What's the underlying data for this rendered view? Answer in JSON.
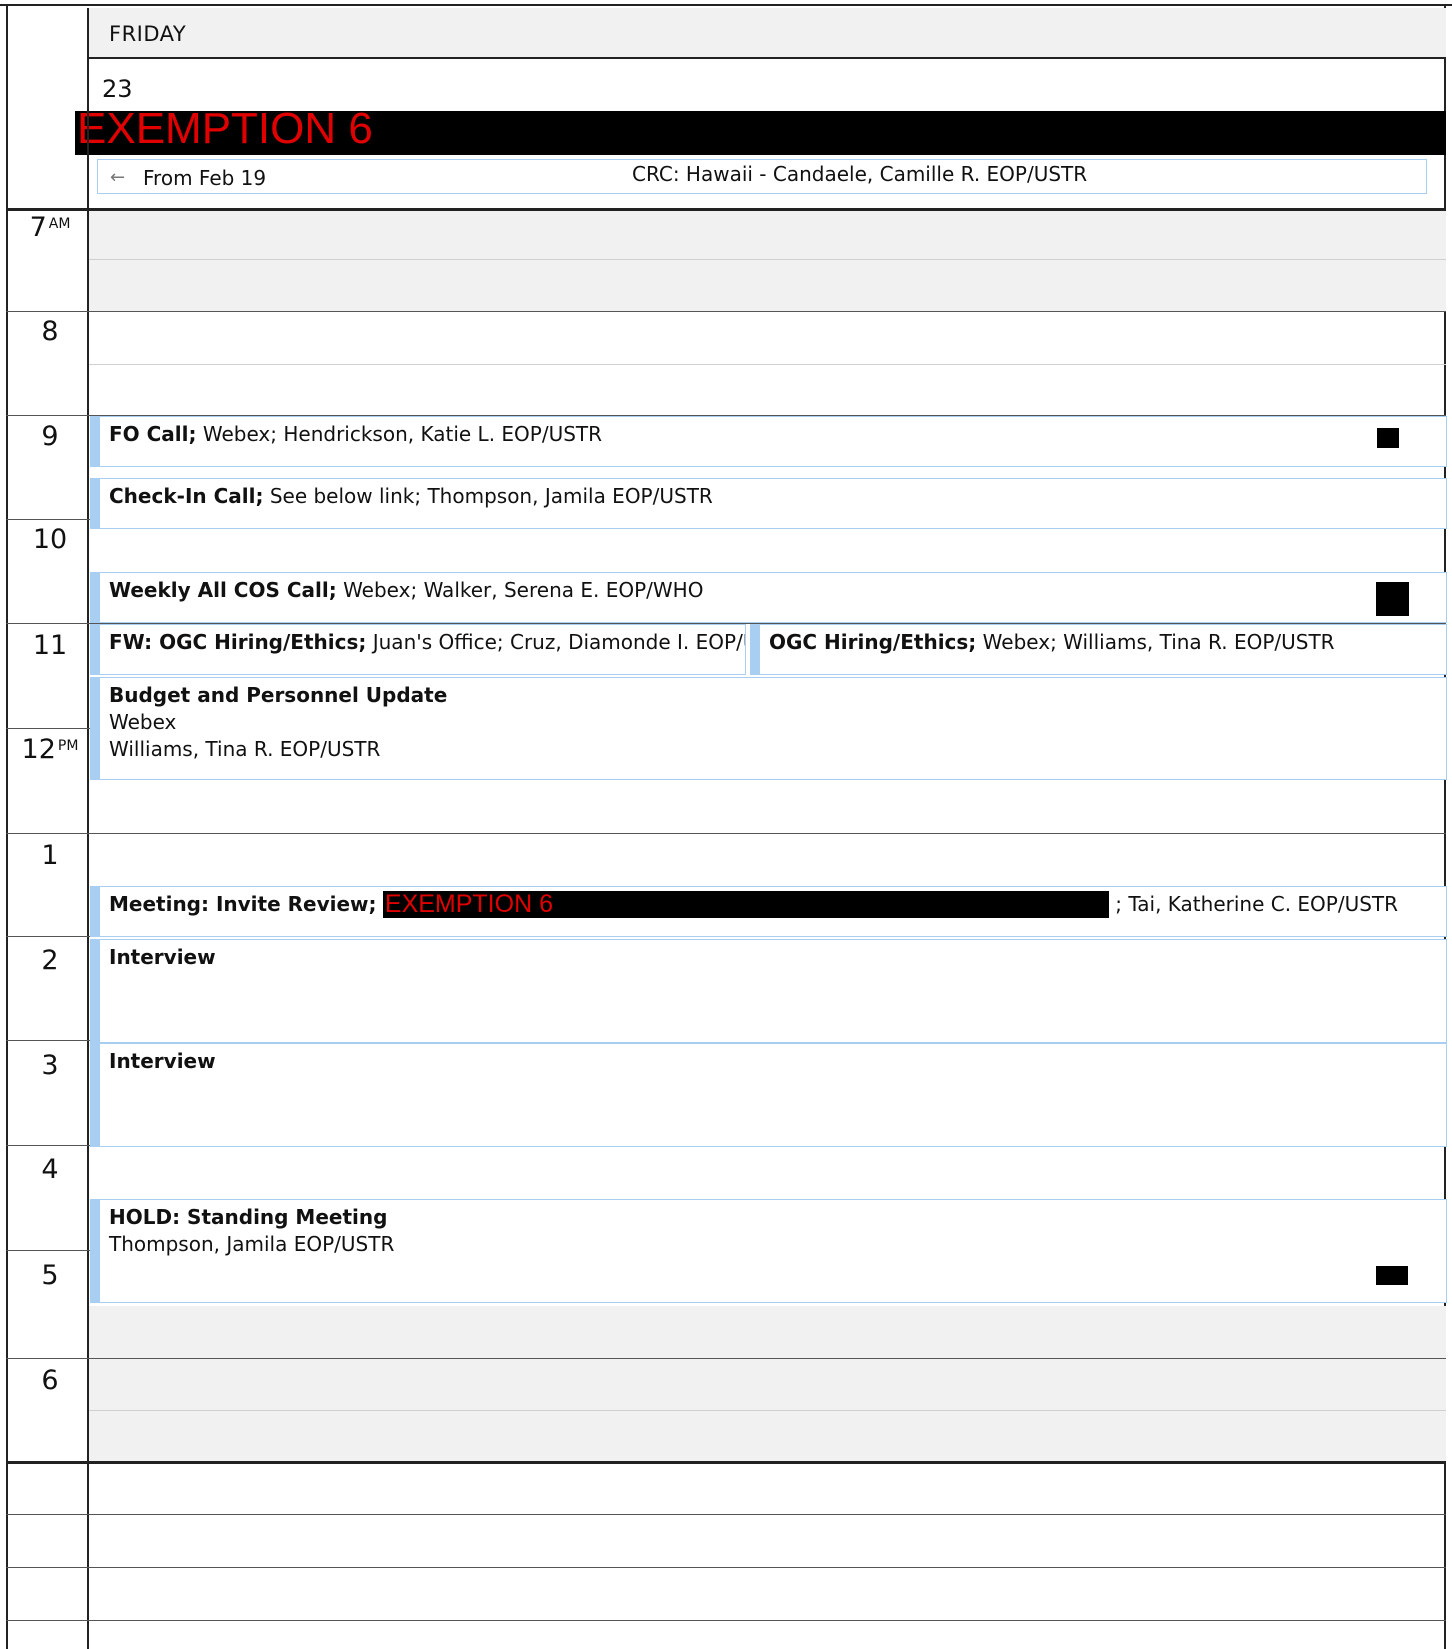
{
  "header": {
    "day_name": "FRIDAY",
    "day_number": "23",
    "redaction_label": "EXEMPTION 6"
  },
  "allday_event": {
    "from_label": "From Feb 19",
    "title": "CRC: Hawaii - Candaele, Camille R. EOP/USTR",
    "icon": "arrow-left-icon"
  },
  "hours": [
    {
      "label": "7",
      "suffix": "AM"
    },
    {
      "label": "8",
      "suffix": ""
    },
    {
      "label": "9",
      "suffix": ""
    },
    {
      "label": "10",
      "suffix": ""
    },
    {
      "label": "11",
      "suffix": ""
    },
    {
      "label": "12",
      "suffix": "PM"
    },
    {
      "label": "1",
      "suffix": ""
    },
    {
      "label": "2",
      "suffix": ""
    },
    {
      "label": "3",
      "suffix": ""
    },
    {
      "label": "4",
      "suffix": ""
    },
    {
      "label": "5",
      "suffix": ""
    },
    {
      "label": "6",
      "suffix": ""
    }
  ],
  "events": {
    "fo_call": {
      "title": "FO Call;",
      "details": " Webex; Hendrickson, Katie L. EOP/USTR"
    },
    "checkin_call": {
      "title": "Check-In Call;",
      "details": " See below link; Thompson, Jamila  EOP/USTR"
    },
    "weekly_cos": {
      "title": "Weekly All COS Call;",
      "details": " Webex; Walker, Serena E. EOP/WHO"
    },
    "fw_ogc": {
      "title": "FW: OGC Hiring/Ethics;",
      "details": " Juan's Office; Cruz, Diamonde I. EOP/USTR"
    },
    "ogc": {
      "title": "OGC Hiring/Ethics;",
      "details": " Webex; Williams, Tina R. EOP/USTR"
    },
    "budget": {
      "title": "Budget and Personnel Update",
      "location": "Webex",
      "organizer": "Williams, Tina R. EOP/USTR"
    },
    "invite_review": {
      "title": "Meeting: Invite Review;",
      "redaction": "EXEMPTION 6",
      "details": "; Tai, Katherine C. EOP/USTR"
    },
    "interview1": {
      "title": "Interview"
    },
    "interview2": {
      "title": "Interview"
    },
    "hold": {
      "title": "HOLD: Standing Meeting",
      "organizer": "Thompson, Jamila EOP/USTR"
    }
  },
  "colors": {
    "event_accent": "#a8cff2",
    "offhours_bg": "#f1f1f1",
    "redaction_text": "#e00000"
  }
}
